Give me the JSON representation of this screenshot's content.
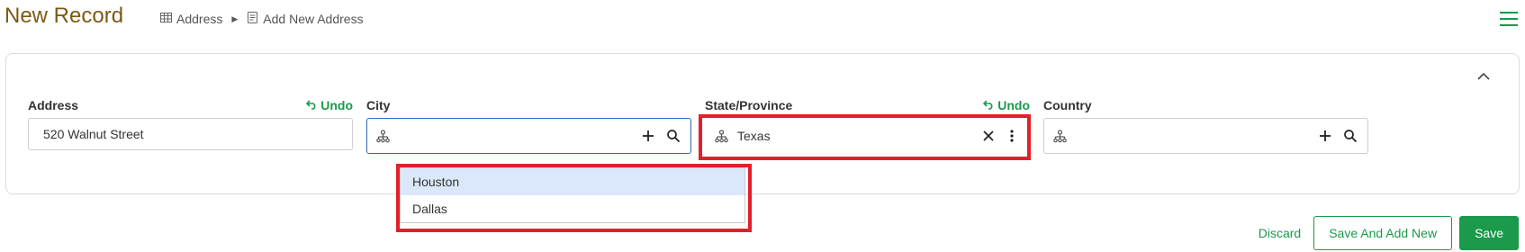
{
  "header": {
    "title": "New Record",
    "breadcrumb": [
      {
        "label": "Address",
        "icon": "table-icon"
      },
      {
        "label": "Add New Address",
        "icon": "form-icon"
      }
    ],
    "menu_icon": "hamburger-menu-icon"
  },
  "form": {
    "address": {
      "label": "Address",
      "value": "520 Walnut Street",
      "undo_label": "Undo"
    },
    "city": {
      "label": "City",
      "value": "",
      "options": [
        "Houston",
        "Dallas"
      ],
      "highlighted_option": "Houston"
    },
    "state": {
      "label": "State/Province",
      "value": "Texas",
      "undo_label": "Undo"
    },
    "country": {
      "label": "Country",
      "value": ""
    }
  },
  "footer": {
    "discard_label": "Discard",
    "save_and_add_new_label": "Save And Add New",
    "save_label": "Save"
  },
  "colors": {
    "accent": "#1a9a4a",
    "title": "#7a5a14",
    "focus_border": "#2b6cb8",
    "highlight_box": "#e0202a",
    "dropdown_highlight": "#dbe8fb"
  }
}
